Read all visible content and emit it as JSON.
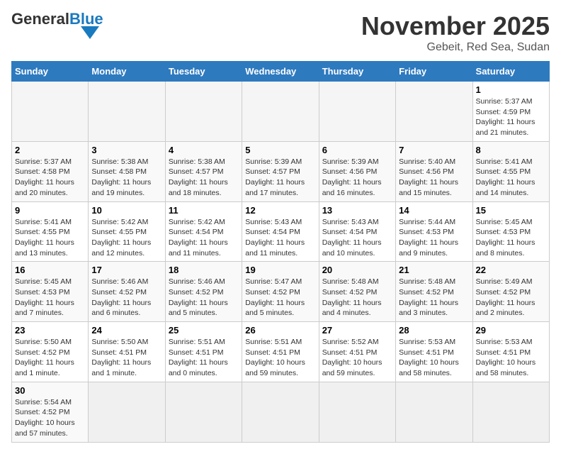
{
  "header": {
    "logo_general": "General",
    "logo_blue": "Blue",
    "month_title": "November 2025",
    "location": "Gebeit, Red Sea, Sudan"
  },
  "days_of_week": [
    "Sunday",
    "Monday",
    "Tuesday",
    "Wednesday",
    "Thursday",
    "Friday",
    "Saturday"
  ],
  "weeks": [
    [
      {
        "day": "",
        "info": ""
      },
      {
        "day": "",
        "info": ""
      },
      {
        "day": "",
        "info": ""
      },
      {
        "day": "",
        "info": ""
      },
      {
        "day": "",
        "info": ""
      },
      {
        "day": "",
        "info": ""
      },
      {
        "day": "1",
        "info": "Sunrise: 5:37 AM\nSunset: 4:59 PM\nDaylight: 11 hours and 21 minutes."
      }
    ],
    [
      {
        "day": "2",
        "info": "Sunrise: 5:37 AM\nSunset: 4:58 PM\nDaylight: 11 hours and 20 minutes."
      },
      {
        "day": "3",
        "info": "Sunrise: 5:38 AM\nSunset: 4:58 PM\nDaylight: 11 hours and 19 minutes."
      },
      {
        "day": "4",
        "info": "Sunrise: 5:38 AM\nSunset: 4:57 PM\nDaylight: 11 hours and 18 minutes."
      },
      {
        "day": "5",
        "info": "Sunrise: 5:39 AM\nSunset: 4:57 PM\nDaylight: 11 hours and 17 minutes."
      },
      {
        "day": "6",
        "info": "Sunrise: 5:39 AM\nSunset: 4:56 PM\nDaylight: 11 hours and 16 minutes."
      },
      {
        "day": "7",
        "info": "Sunrise: 5:40 AM\nSunset: 4:56 PM\nDaylight: 11 hours and 15 minutes."
      },
      {
        "day": "8",
        "info": "Sunrise: 5:41 AM\nSunset: 4:55 PM\nDaylight: 11 hours and 14 minutes."
      }
    ],
    [
      {
        "day": "9",
        "info": "Sunrise: 5:41 AM\nSunset: 4:55 PM\nDaylight: 11 hours and 13 minutes."
      },
      {
        "day": "10",
        "info": "Sunrise: 5:42 AM\nSunset: 4:55 PM\nDaylight: 11 hours and 12 minutes."
      },
      {
        "day": "11",
        "info": "Sunrise: 5:42 AM\nSunset: 4:54 PM\nDaylight: 11 hours and 11 minutes."
      },
      {
        "day": "12",
        "info": "Sunrise: 5:43 AM\nSunset: 4:54 PM\nDaylight: 11 hours and 11 minutes."
      },
      {
        "day": "13",
        "info": "Sunrise: 5:43 AM\nSunset: 4:54 PM\nDaylight: 11 hours and 10 minutes."
      },
      {
        "day": "14",
        "info": "Sunrise: 5:44 AM\nSunset: 4:53 PM\nDaylight: 11 hours and 9 minutes."
      },
      {
        "day": "15",
        "info": "Sunrise: 5:45 AM\nSunset: 4:53 PM\nDaylight: 11 hours and 8 minutes."
      }
    ],
    [
      {
        "day": "16",
        "info": "Sunrise: 5:45 AM\nSunset: 4:53 PM\nDaylight: 11 hours and 7 minutes."
      },
      {
        "day": "17",
        "info": "Sunrise: 5:46 AM\nSunset: 4:52 PM\nDaylight: 11 hours and 6 minutes."
      },
      {
        "day": "18",
        "info": "Sunrise: 5:46 AM\nSunset: 4:52 PM\nDaylight: 11 hours and 5 minutes."
      },
      {
        "day": "19",
        "info": "Sunrise: 5:47 AM\nSunset: 4:52 PM\nDaylight: 11 hours and 5 minutes."
      },
      {
        "day": "20",
        "info": "Sunrise: 5:48 AM\nSunset: 4:52 PM\nDaylight: 11 hours and 4 minutes."
      },
      {
        "day": "21",
        "info": "Sunrise: 5:48 AM\nSunset: 4:52 PM\nDaylight: 11 hours and 3 minutes."
      },
      {
        "day": "22",
        "info": "Sunrise: 5:49 AM\nSunset: 4:52 PM\nDaylight: 11 hours and 2 minutes."
      }
    ],
    [
      {
        "day": "23",
        "info": "Sunrise: 5:50 AM\nSunset: 4:52 PM\nDaylight: 11 hours and 1 minute."
      },
      {
        "day": "24",
        "info": "Sunrise: 5:50 AM\nSunset: 4:51 PM\nDaylight: 11 hours and 1 minute."
      },
      {
        "day": "25",
        "info": "Sunrise: 5:51 AM\nSunset: 4:51 PM\nDaylight: 11 hours and 0 minutes."
      },
      {
        "day": "26",
        "info": "Sunrise: 5:51 AM\nSunset: 4:51 PM\nDaylight: 10 hours and 59 minutes."
      },
      {
        "day": "27",
        "info": "Sunrise: 5:52 AM\nSunset: 4:51 PM\nDaylight: 10 hours and 59 minutes."
      },
      {
        "day": "28",
        "info": "Sunrise: 5:53 AM\nSunset: 4:51 PM\nDaylight: 10 hours and 58 minutes."
      },
      {
        "day": "29",
        "info": "Sunrise: 5:53 AM\nSunset: 4:51 PM\nDaylight: 10 hours and 58 minutes."
      }
    ],
    [
      {
        "day": "30",
        "info": "Sunrise: 5:54 AM\nSunset: 4:52 PM\nDaylight: 10 hours and 57 minutes."
      },
      {
        "day": "",
        "info": ""
      },
      {
        "day": "",
        "info": ""
      },
      {
        "day": "",
        "info": ""
      },
      {
        "day": "",
        "info": ""
      },
      {
        "day": "",
        "info": ""
      },
      {
        "day": "",
        "info": ""
      }
    ]
  ]
}
